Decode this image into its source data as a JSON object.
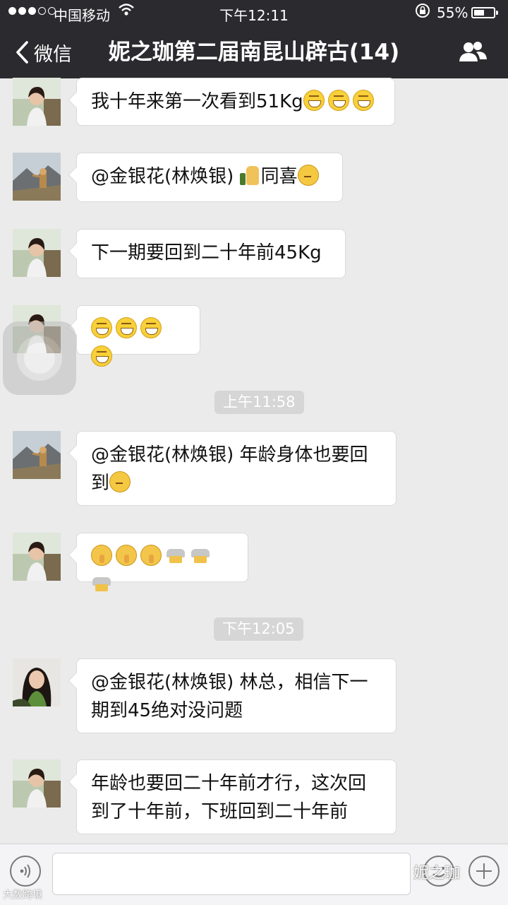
{
  "status_bar": {
    "carrier": "中国移动",
    "time": "下午12:11",
    "battery_percent": "55%",
    "battery_level": 0.55,
    "signal_bars_filled": 3,
    "signal_bars_total": 5
  },
  "nav": {
    "back_label": "微信",
    "title": "妮之珈第二届南昆山辟古(14)",
    "icons": [
      "chevron-left-icon",
      "group-members-icon"
    ]
  },
  "messages": [
    {
      "sender_avatar": "avatar-woman-balcony",
      "segments": [
        {
          "t": "text",
          "v": "我十年来第一次看到51Kg"
        },
        {
          "t": "emoji",
          "v": "grin"
        },
        {
          "t": "emoji",
          "v": "grin"
        },
        {
          "t": "emoji",
          "v": "grin"
        }
      ]
    },
    {
      "sender_avatar": "avatar-mountain-figure",
      "segments": [
        {
          "t": "text",
          "v": "@金银花(林焕银) "
        },
        {
          "t": "emoji",
          "v": "thumbs-up"
        },
        {
          "t": "text",
          "v": "同喜"
        },
        {
          "t": "emoji",
          "v": "think"
        }
      ]
    },
    {
      "sender_avatar": "avatar-woman-balcony",
      "segments": [
        {
          "t": "text",
          "v": "下一期要回到二十年前45Kg"
        }
      ]
    },
    {
      "sender_avatar": "avatar-woman-balcony",
      "segments": [
        {
          "t": "emoji",
          "v": "grin"
        },
        {
          "t": "emoji",
          "v": "grin"
        },
        {
          "t": "emoji",
          "v": "grin"
        },
        {
          "t": "emoji",
          "v": "grin"
        }
      ]
    },
    {
      "timestamp": "上午11:58"
    },
    {
      "sender_avatar": "avatar-mountain-figure",
      "segments": [
        {
          "t": "text",
          "v": "@金银花(林焕银) 年龄身体也要回到"
        },
        {
          "t": "emoji",
          "v": "think"
        }
      ]
    },
    {
      "sender_avatar": "avatar-woman-balcony",
      "segments": [
        {
          "t": "emoji",
          "v": "shush"
        },
        {
          "t": "emoji",
          "v": "shush"
        },
        {
          "t": "emoji",
          "v": "shush"
        },
        {
          "t": "emoji",
          "v": "bow"
        },
        {
          "t": "emoji",
          "v": "bow"
        },
        {
          "t": "emoji",
          "v": "bow"
        }
      ]
    },
    {
      "timestamp": "下午12:05"
    },
    {
      "sender_avatar": "avatar-woman-green-scarf",
      "segments": [
        {
          "t": "text",
          "v": "@金银花(林焕银) 林总，相信下一期到45绝对没问题"
        }
      ]
    },
    {
      "sender_avatar": "avatar-woman-balcony",
      "segments": [
        {
          "t": "text",
          "v": "年龄也要回二十年前才行，这次回到了十年前，下班回到二十年前"
        }
      ]
    }
  ],
  "input_bar": {
    "placeholder": "",
    "icons": [
      "voice-icon",
      "emoji-icon",
      "plus-icon"
    ]
  },
  "watermarks": {
    "right": "妮之珈",
    "left": "大数跨境"
  },
  "colors": {
    "header_bg": "#2b2b2f",
    "chat_bg": "#ebebeb",
    "bubble_bg": "#ffffff",
    "timestamp_chip": "#d6d6d6"
  }
}
